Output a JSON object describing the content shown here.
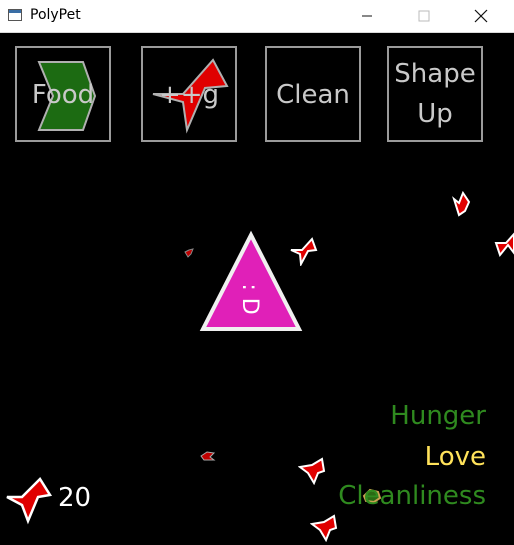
{
  "window": {
    "title": "PolyPet",
    "controls": [
      "minimize",
      "maximize",
      "close"
    ]
  },
  "toolbar": {
    "food_label": "Food",
    "gift_label": "++g",
    "clean_label": "Clean",
    "shape_up_label_line1": "Shape",
    "shape_up_label_line2": "Up"
  },
  "stats": {
    "hunger_label": "Hunger",
    "love_label": "Love",
    "cleanliness_label": "Cleanliness"
  },
  "currency": {
    "count": "20"
  },
  "pet": {
    "face": ": D"
  },
  "colors": {
    "background": "#000000",
    "pet_fill": "#e020b8",
    "pet_outline": "#f0f0f0",
    "food_green": "#1c6b12",
    "gift_red": "#e00000",
    "hunger": "#2f8a1f",
    "love": "#ffe25a",
    "cleanliness": "#2f8a1f",
    "button_border": "#9b9b9b",
    "button_text": "#c9c9c9"
  }
}
